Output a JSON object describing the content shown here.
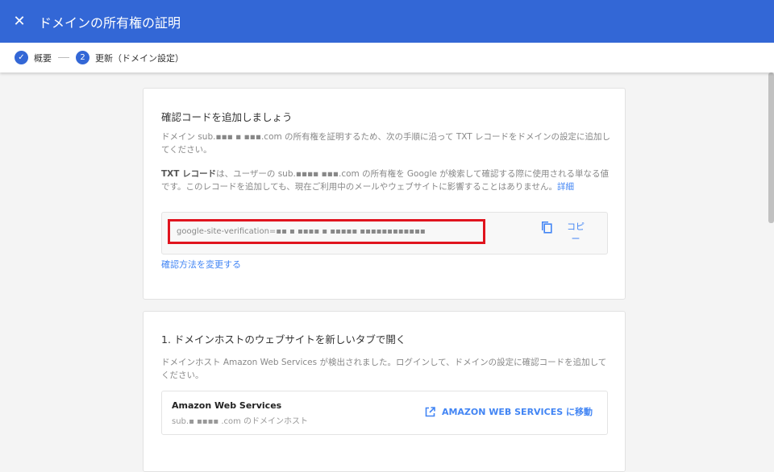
{
  "header": {
    "title": "ドメインの所有権の証明",
    "close_icon": "close-icon"
  },
  "stepper": {
    "steps": [
      {
        "label": "概要",
        "marker": "✓"
      },
      {
        "label": "更新（ドメイン設定）",
        "marker": "2"
      }
    ]
  },
  "card1": {
    "title": "確認コードを追加しましょう",
    "intro": "ドメイン sub.▪▪▪ ▪ ▪▪▪.com の所有権を証明するため、次の手順に沿って TXT レコードをドメインの設定に追加してください。",
    "txt_bold": "TXT レコード",
    "txt_desc": "は、ユーザーの sub.▪▪▪▪ ▪▪▪.com の所有権を Google が検索して確認する際に使用される単なる値です。このレコードを追加しても、現在ご利用中のメールやウェブサイトに影響することはありません。",
    "details_link": "詳細",
    "code": "google-site-verification=▪▪ ▪ ▪▪▪▪ ▪ ▪▪▪▪▪ ▪▪▪▪▪▪▪▪▪▪▪▪",
    "copy_label": "コピー",
    "change_method": "確認方法を変更する"
  },
  "card2": {
    "title": "1. ドメインホストのウェブサイトを新しいタブで開く",
    "desc": "ドメインホスト Amazon Web Services が検出されました。ログインして、ドメインの設定に確認コードを追加してください。",
    "host_name": "Amazon Web Services",
    "host_sub": "sub.▪ ▪▪▪▪ .com のドメインホスト",
    "go_button": "AMAZON WEB SERVICES に移動"
  },
  "colors": {
    "primary": "#3367d6",
    "link": "#4285f4",
    "highlight": "#e0141e"
  }
}
